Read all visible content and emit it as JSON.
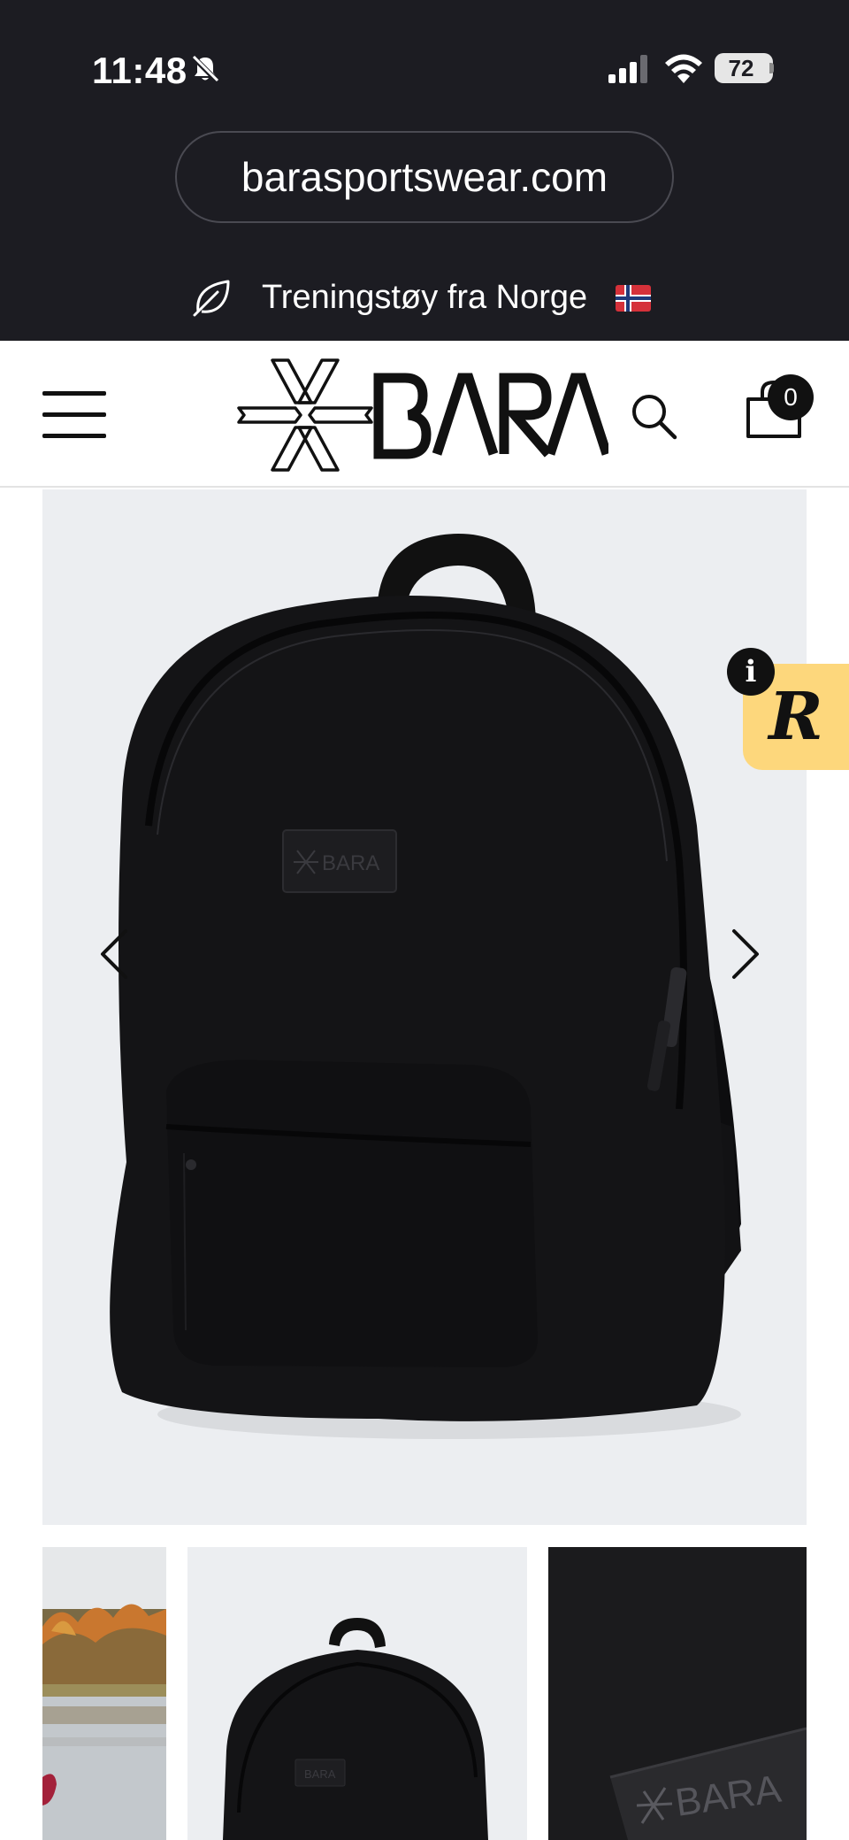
{
  "status_bar": {
    "time": "11:48",
    "battery": "72",
    "icons": [
      "bell-slash-icon",
      "signal-icon",
      "wifi-icon",
      "battery-icon"
    ]
  },
  "browser": {
    "url": "barasportswear.com"
  },
  "promo_bar": {
    "text": "Treningstøy fra Norge",
    "icon": "leaf-icon",
    "flag": "norway-flag-icon"
  },
  "header": {
    "logo_alt": "BARA",
    "cart_count": "0",
    "icons": [
      "menu-icon",
      "search-icon",
      "cart-icon"
    ]
  },
  "gallery": {
    "product_logo_text": "BARA",
    "prev_icon": "chevron-left-icon",
    "next_icon": "chevron-right-icon",
    "thumbnails": [
      "lifestyle-photo",
      "backpack-front",
      "logo-patch-closeup"
    ],
    "thumb_logo_text": "BARA"
  },
  "reviews_widget": {
    "logo": "R",
    "info": "i"
  },
  "colors": {
    "top_background": "#1c1c22",
    "gallery_background": "#eceef1",
    "reviews_tab": "#fdd77c",
    "ink": "#111111"
  }
}
